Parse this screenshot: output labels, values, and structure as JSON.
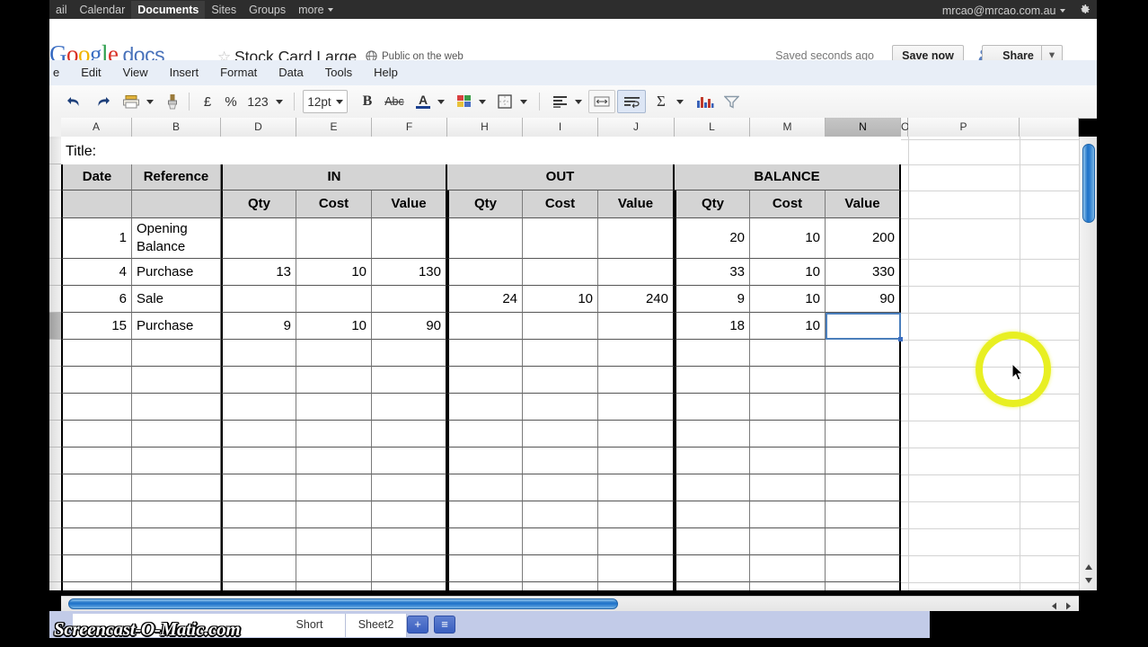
{
  "gbar": {
    "nav_items": [
      {
        "label": "ail",
        "active": false
      },
      {
        "label": "Calendar",
        "active": false
      },
      {
        "label": "Documents",
        "active": true
      },
      {
        "label": "Sites",
        "active": false
      },
      {
        "label": "Groups",
        "active": false
      },
      {
        "label": "more",
        "active": false
      }
    ],
    "account_email": "mrcao@mrcao.com.au",
    "gear_icon": "gear-icon"
  },
  "header": {
    "logo_text": "Google",
    "logo_product": "docs",
    "star_icon": "star-icon",
    "doc_title": "Stock Card Large",
    "globe_icon": "globe-icon",
    "visibility": "Public on the web",
    "saved_status": "Saved seconds ago",
    "save_now_label": "Save now",
    "share_label": "Share",
    "share_icon": "person-share-icon",
    "share_caret": "▾"
  },
  "menubar": {
    "items": [
      "e",
      "Edit",
      "View",
      "Insert",
      "Format",
      "Data",
      "Tools",
      "Help"
    ]
  },
  "toolbar": {
    "items": [
      {
        "name": "undo-icon",
        "glyph": "↶"
      },
      {
        "name": "redo-icon",
        "glyph": "↷"
      },
      {
        "name": "print-icon",
        "glyph": "🖶"
      },
      {
        "name": "print-dropdown-caret",
        "glyph": "▾"
      },
      {
        "name": "paint-format-icon",
        "glyph": "🖌"
      },
      {
        "name": "currency-pound-icon",
        "glyph": "£"
      },
      {
        "name": "percent-icon",
        "glyph": "%"
      },
      {
        "name": "number-format-label",
        "glyph": "123"
      },
      {
        "name": "number-format-caret",
        "glyph": "▾"
      },
      {
        "name": "font-size-value",
        "glyph": "12pt"
      },
      {
        "name": "font-size-caret",
        "glyph": "▾"
      },
      {
        "name": "bold-icon",
        "glyph": "B"
      },
      {
        "name": "strikethrough-icon",
        "glyph": "Abc"
      },
      {
        "name": "text-color-icon",
        "glyph": "A"
      },
      {
        "name": "text-color-caret",
        "glyph": "▾"
      },
      {
        "name": "fill-color-icon",
        "glyph": "▦"
      },
      {
        "name": "fill-color-caret",
        "glyph": "▾"
      },
      {
        "name": "borders-icon",
        "glyph": "⬚"
      },
      {
        "name": "borders-caret",
        "glyph": "▾"
      },
      {
        "name": "align-icon",
        "glyph": "≡"
      },
      {
        "name": "align-caret",
        "glyph": "▾"
      },
      {
        "name": "merge-cells-icon",
        "glyph": "↔"
      },
      {
        "name": "wrap-text-icon",
        "glyph": "↵"
      },
      {
        "name": "sum-icon",
        "glyph": "Σ"
      },
      {
        "name": "sum-caret",
        "glyph": "▾"
      },
      {
        "name": "insert-chart-icon",
        "glyph": "█"
      },
      {
        "name": "filter-icon",
        "glyph": "▽"
      }
    ],
    "font_size": "12pt",
    "number_format": "123"
  },
  "grid": {
    "column_headers": [
      "A",
      "B",
      "D",
      "E",
      "F",
      "H",
      "I",
      "J",
      "L",
      "M",
      "N",
      "O",
      "P",
      ""
    ],
    "selected_column": "N",
    "selected_cell_ref": "N8"
  },
  "sheet_content": {
    "title_cell": "Title:",
    "group_headers": [
      "Date",
      "Reference",
      "IN",
      "OUT",
      "BALANCE"
    ],
    "sub_headers": [
      "",
      "",
      "Qty",
      "Cost",
      "Value",
      "Qty",
      "Cost",
      "Value",
      "Qty",
      "Cost",
      "Value"
    ],
    "rows": [
      {
        "date": "1",
        "reference": "Opening\nBalance",
        "in_qty": "",
        "in_cost": "",
        "in_value": "",
        "out_qty": "",
        "out_cost": "",
        "out_value": "",
        "bal_qty": "20",
        "bal_cost": "10",
        "bal_value": "200"
      },
      {
        "date": "4",
        "reference": "Purchase",
        "in_qty": "13",
        "in_cost": "10",
        "in_value": "130",
        "out_qty": "",
        "out_cost": "",
        "out_value": "",
        "bal_qty": "33",
        "bal_cost": "10",
        "bal_value": "330"
      },
      {
        "date": "6",
        "reference": "Sale",
        "in_qty": "",
        "in_cost": "",
        "in_value": "",
        "out_qty": "24",
        "out_cost": "10",
        "out_value": "240",
        "bal_qty": "9",
        "bal_cost": "10",
        "bal_value": "90"
      },
      {
        "date": "15",
        "reference": "Purchase",
        "in_qty": "9",
        "in_cost": "10",
        "in_value": "90",
        "out_qty": "",
        "out_cost": "",
        "out_value": "",
        "bal_qty": "18",
        "bal_cost": "10",
        "bal_value": ""
      },
      {
        "date": "",
        "reference": "",
        "in_qty": "",
        "in_cost": "",
        "in_value": "",
        "out_qty": "",
        "out_cost": "",
        "out_value": "",
        "bal_qty": "",
        "bal_cost": "",
        "bal_value": ""
      },
      {
        "date": "",
        "reference": "",
        "in_qty": "",
        "in_cost": "",
        "in_value": "",
        "out_qty": "",
        "out_cost": "",
        "out_value": "",
        "bal_qty": "",
        "bal_cost": "",
        "bal_value": ""
      },
      {
        "date": "",
        "reference": "",
        "in_qty": "",
        "in_cost": "",
        "in_value": "",
        "out_qty": "",
        "out_cost": "",
        "out_value": "",
        "bal_qty": "",
        "bal_cost": "",
        "bal_value": ""
      },
      {
        "date": "",
        "reference": "",
        "in_qty": "",
        "in_cost": "",
        "in_value": "",
        "out_qty": "",
        "out_cost": "",
        "out_value": "",
        "bal_qty": "",
        "bal_cost": "",
        "bal_value": ""
      },
      {
        "date": "",
        "reference": "",
        "in_qty": "",
        "in_cost": "",
        "in_value": "",
        "out_qty": "",
        "out_cost": "",
        "out_value": "",
        "bal_qty": "",
        "bal_cost": "",
        "bal_value": ""
      },
      {
        "date": "",
        "reference": "",
        "in_qty": "",
        "in_cost": "",
        "in_value": "",
        "out_qty": "",
        "out_cost": "",
        "out_value": "",
        "bal_qty": "",
        "bal_cost": "",
        "bal_value": ""
      },
      {
        "date": "",
        "reference": "",
        "in_qty": "",
        "in_cost": "",
        "in_value": "",
        "out_qty": "",
        "out_cost": "",
        "out_value": "",
        "bal_qty": "",
        "bal_cost": "",
        "bal_value": ""
      },
      {
        "date": "",
        "reference": "",
        "in_qty": "",
        "in_cost": "",
        "in_value": "",
        "out_qty": "",
        "out_cost": "",
        "out_value": "",
        "bal_qty": "",
        "bal_cost": "",
        "bal_value": ""
      },
      {
        "date": "",
        "reference": "",
        "in_qty": "",
        "in_cost": "",
        "in_value": "",
        "out_qty": "",
        "out_cost": "",
        "out_value": "",
        "bal_qty": "",
        "bal_cost": "",
        "bal_value": ""
      },
      {
        "date": "",
        "reference": "",
        "in_qty": "",
        "in_cost": "",
        "in_value": "",
        "out_qty": "",
        "out_cost": "",
        "out_value": "",
        "bal_qty": "",
        "bal_cost": "",
        "bal_value": ""
      },
      {
        "date": "",
        "reference": "",
        "in_qty": "",
        "in_cost": "",
        "in_value": "",
        "out_qty": "",
        "out_cost": "",
        "out_value": "",
        "bal_qty": "",
        "bal_cost": "",
        "bal_value": ""
      }
    ]
  },
  "tabs": {
    "items": [
      {
        "label": "Short",
        "active": false
      },
      {
        "label": "Sheet2",
        "active": false
      }
    ],
    "add_sheet_label": "+",
    "all_sheets_label": "≡"
  },
  "watermark": {
    "text": "Screencast-O-Matic.com"
  },
  "colors": {
    "accent_blue": "#3b6ec3",
    "header_fill": "#d4d4d4",
    "selection_border": "#4a7ebb",
    "highlight_yellow": "#e8ef22",
    "tabbar_bg": "#c2cbe8"
  }
}
